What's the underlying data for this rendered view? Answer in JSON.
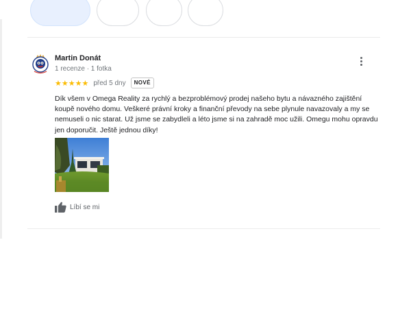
{
  "review": {
    "author_name": "Martin Donát",
    "author_meta": "1 recenze · 1 fotka",
    "stars": "★★★★★",
    "time_ago": "před 5 dny",
    "badge": "NOVÉ",
    "text": "Dík všem v Omega Reality za rychlý a bezproblémový prodej našeho bytu a návazného zajištění koupě nového domu. Veškeré právní kroky a finanční převody na sebe plynule navazovaly a my se nemuseli o nic starat. Už jsme se zabydleli a léto jsme si na zahradě moc užili. Omegu mohu opravdu jen doporučit. Ještě jednou díky!",
    "like_label": "Líbí se mi",
    "rating_value": 5,
    "star_color": "#fbbc04"
  },
  "icons": {
    "more": "more-vert-icon",
    "like": "thumb-up-icon"
  }
}
